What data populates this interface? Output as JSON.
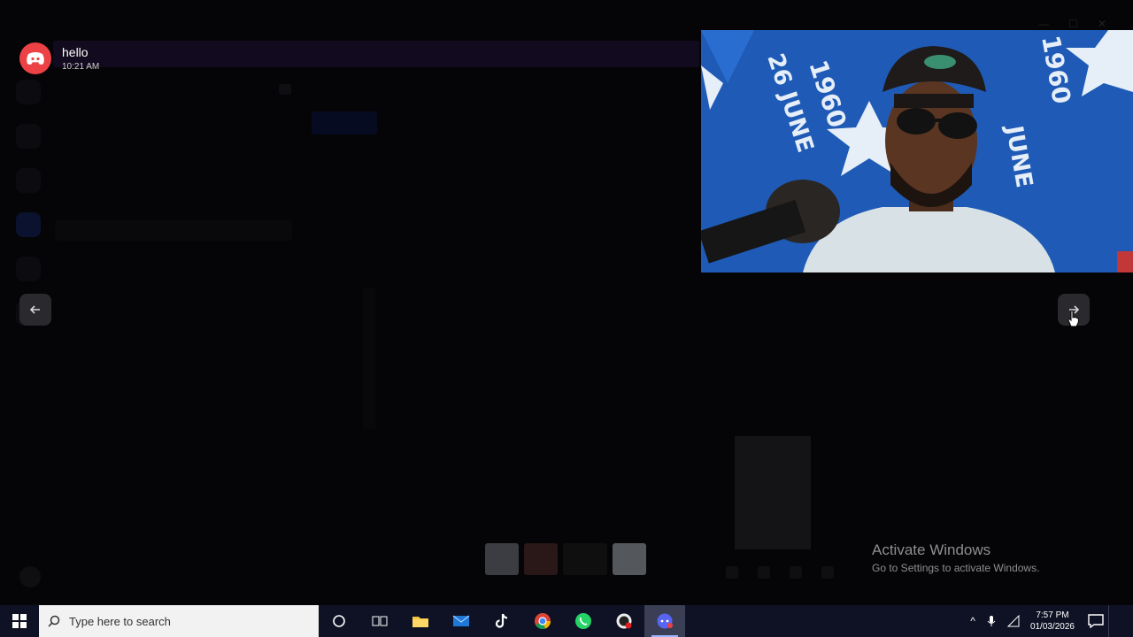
{
  "notification": {
    "app_icon": "discord-icon",
    "title": "hello",
    "time": "10:21 AM"
  },
  "viewer": {
    "prev_icon": "arrow-left-icon",
    "next_icon": "arrow-right-icon"
  },
  "webcam": {
    "flag_text_left": "26 JUNE 1960",
    "flag_text_right": "1960 JUNE",
    "brand_color": "#1f5bb6"
  },
  "activation_watermark": {
    "title": "Activate Windows",
    "subtitle": "Go to Settings to activate Windows."
  },
  "taskbar": {
    "search_placeholder": "Type here to search",
    "apps": [
      "cortana-icon",
      "task-view-icon",
      "file-explorer-icon",
      "mail-icon",
      "tiktok-icon",
      "chrome-icon",
      "whatsapp-icon",
      "recorder-icon",
      "discord-icon"
    ],
    "clock_time": "7:57 PM",
    "clock_date": "01/03/2026"
  },
  "colors": {
    "discord_red": "#ed4245",
    "taskbar_bg": "#0e1224",
    "watermark_gray": "#8e8e8e"
  }
}
